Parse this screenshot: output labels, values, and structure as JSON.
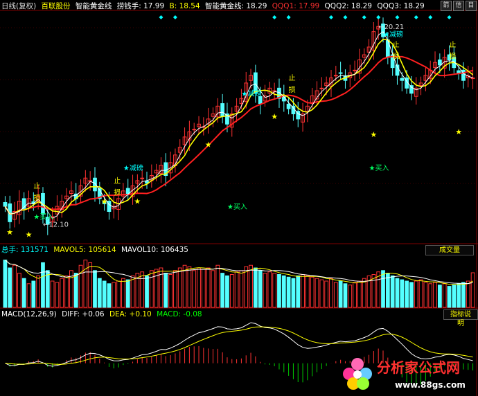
{
  "header_main": {
    "period": "日线(复权)",
    "stock": "百联股份",
    "indicator": "智能黄金线",
    "items": [
      {
        "label": "捞钱手: 17.99",
        "color": "#ffffff"
      },
      {
        "label": "B: 18.54",
        "color": "#ffff00"
      },
      {
        "label": "智能黄金线: 18.29",
        "color": "#ffffff"
      },
      {
        "label": "QQQ1: 17.99",
        "color": "#ff3030"
      },
      {
        "label": "QQQ2: 18.29",
        "color": "#ffffff"
      },
      {
        "label": "QQQ3: 18.29",
        "color": "#ffffff"
      }
    ]
  },
  "top_buttons": [
    "箭",
    "信",
    "目"
  ],
  "header_vol": {
    "items": [
      {
        "label": "总手: 131571",
        "color": "#00ffff"
      },
      {
        "label": "MAVOL5: 105614",
        "color": "#ffff00"
      },
      {
        "label": "MAVOL10: 106435",
        "color": "#ffffff"
      }
    ],
    "button": "成交量"
  },
  "header_macd": {
    "items": [
      {
        "label": "MACD(12,26,9)",
        "color": "#ffffff"
      },
      {
        "label": "DIFF: +0.06",
        "color": "#ffffff"
      },
      {
        "label": "DEA: +0.10",
        "color": "#ffff00"
      },
      {
        "label": "MACD: -0.08",
        "color": "#00ff00"
      }
    ],
    "button": "指标说明"
  },
  "annotations": {
    "buy": "买入",
    "reduce": "减磅",
    "stop_top": "止",
    "stop_bottom": "损",
    "low_price": "12.10",
    "high_price": "20.21"
  },
  "watermark": {
    "title": "分析家公式网",
    "url": "www.88gs.com"
  },
  "colors": {
    "up": "#ff3232",
    "down": "#54ffff",
    "ma_white": "#ffffff",
    "ma_yellow": "#ffff00",
    "ma_red": "#ff2020",
    "star": "#ffff00",
    "buy": "#00ff60",
    "reduce": "#00ffff",
    "stop": "#ffff00",
    "grid": "#800000"
  },
  "chart_data": [
    {
      "type": "candlestick",
      "name": "price",
      "ylim": [
        11.6,
        20.6
      ],
      "days": 100,
      "close": [
        13.0,
        12.4,
        12.8,
        13.2,
        12.9,
        13.3,
        13.1,
        13.4,
        12.7,
        12.3,
        12.6,
        13.0,
        13.2,
        13.4,
        13.6,
        13.3,
        13.8,
        14.1,
        14.0,
        13.6,
        13.3,
        13.1,
        12.8,
        13.0,
        13.3,
        13.6,
        13.5,
        13.8,
        14.0,
        14.1,
        13.9,
        14.2,
        14.4,
        14.6,
        14.2,
        14.7,
        15.0,
        15.3,
        15.7,
        15.9,
        16.0,
        16.2,
        16.1,
        16.4,
        16.6,
        16.9,
        16.5,
        16.2,
        16.6,
        16.9,
        17.2,
        17.8,
        18.1,
        17.4,
        17.0,
        17.3,
        17.6,
        17.5,
        17.2,
        17.1,
        16.8,
        16.6,
        16.4,
        16.6,
        16.9,
        17.3,
        17.5,
        17.6,
        17.8,
        18.0,
        18.1,
        18.2,
        17.9,
        18.2,
        18.3,
        18.7,
        18.9,
        19.2,
        19.8,
        20.0,
        19.6,
        18.8,
        18.4,
        18.1,
        17.9,
        17.6,
        17.4,
        17.6,
        17.8,
        18.1,
        18.3,
        18.6,
        18.5,
        18.8,
        18.7,
        18.4,
        18.2,
        17.9,
        18.1,
        18.0
      ],
      "volume": [
        180000,
        150000,
        160000,
        130000,
        110000,
        90000,
        100000,
        120000,
        170000,
        140000,
        100000,
        95000,
        110000,
        120000,
        140000,
        130000,
        160000,
        180000,
        170000,
        140000,
        110000,
        100000,
        90000,
        95000,
        100000,
        110000,
        105000,
        120000,
        130000,
        135000,
        120000,
        140000,
        145000,
        150000,
        130000,
        125000,
        140000,
        150000,
        160000,
        155000,
        140000,
        150000,
        145000,
        150000,
        140000,
        160000,
        130000,
        120000,
        125000,
        135000,
        140000,
        155000,
        160000,
        150000,
        140000,
        130000,
        135000,
        130000,
        125000,
        120000,
        115000,
        110000,
        120000,
        125000,
        120000,
        115000,
        110000,
        105000,
        100000,
        110000,
        95000,
        100000,
        90000,
        85000,
        95000,
        100000,
        110000,
        120000,
        125000,
        135000,
        140000,
        130000,
        120000,
        110000,
        105000,
        100000,
        95000,
        100000,
        105000,
        95000,
        90000,
        95000,
        85000,
        90000,
        80000,
        85000,
        90000,
        95000,
        100000,
        131571
      ]
    },
    {
      "type": "bar",
      "name": "volume",
      "ylim": [
        0,
        200000
      ]
    },
    {
      "type": "bar",
      "name": "MACD",
      "ylim": [
        -0.7,
        1.0
      ],
      "lines": [
        "DIFF",
        "DEA"
      ]
    }
  ]
}
